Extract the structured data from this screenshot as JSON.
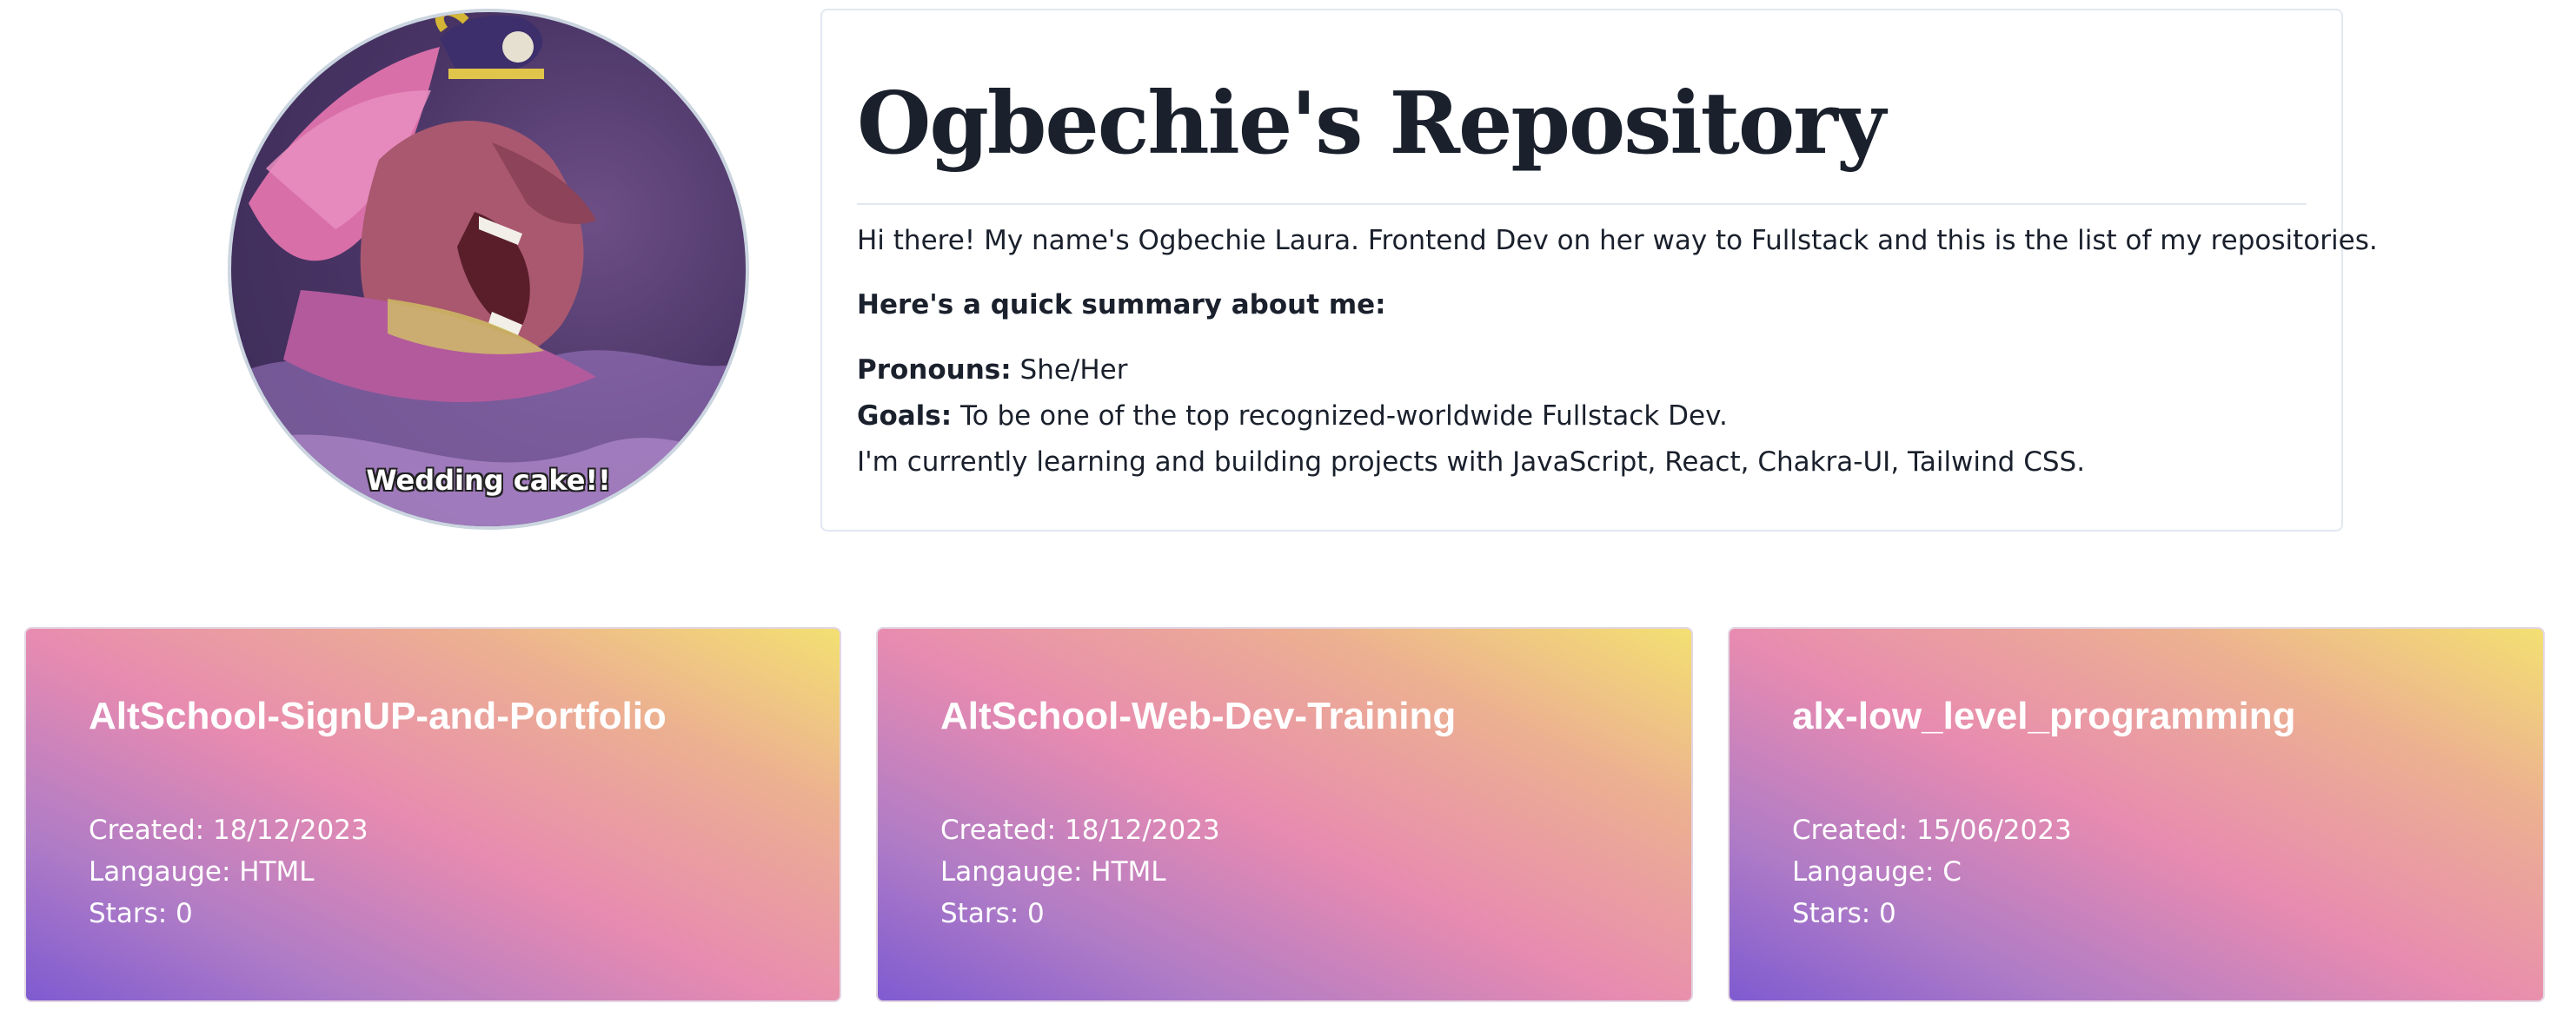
{
  "profile": {
    "avatar_caption": "Wedding cake!!"
  },
  "intro": {
    "title": "Ogbechie's Repository",
    "greeting": "Hi there! My name's Ogbechie Laura. Frontend Dev on her way to Fullstack and this is the list of my repositories.",
    "summary_heading": "Here's a quick summary about me:",
    "pronouns_label": "Pronouns:",
    "pronouns_value": "She/Her",
    "goals_label": "Goals:",
    "goals_value": "To be one of the top recognized-worldwide Fullstack Dev.",
    "learning": "I'm currently learning and building projects with JavaScript, React, Chakra-UI, Tailwind CSS."
  },
  "repos": [
    {
      "name": "AltSchool-SignUP-and-Portfolio",
      "created": "Created: 18/12/2023",
      "language": "Langauge: HTML",
      "stars": "Stars: 0"
    },
    {
      "name": "AltSchool-Web-Dev-Training",
      "created": "Created: 18/12/2023",
      "language": "Langauge: HTML",
      "stars": "Stars: 0"
    },
    {
      "name": "alx-low_level_programming",
      "created": "Created: 15/06/2023",
      "language": "Langauge: C",
      "stars": "Stars: 0"
    }
  ],
  "colors": {
    "title_text": "#1a202c",
    "card_border": "#e2e8f0",
    "gradient_start": "#7f5bd1",
    "gradient_mid": "#e88bb0",
    "gradient_end": "#f3e072"
  }
}
